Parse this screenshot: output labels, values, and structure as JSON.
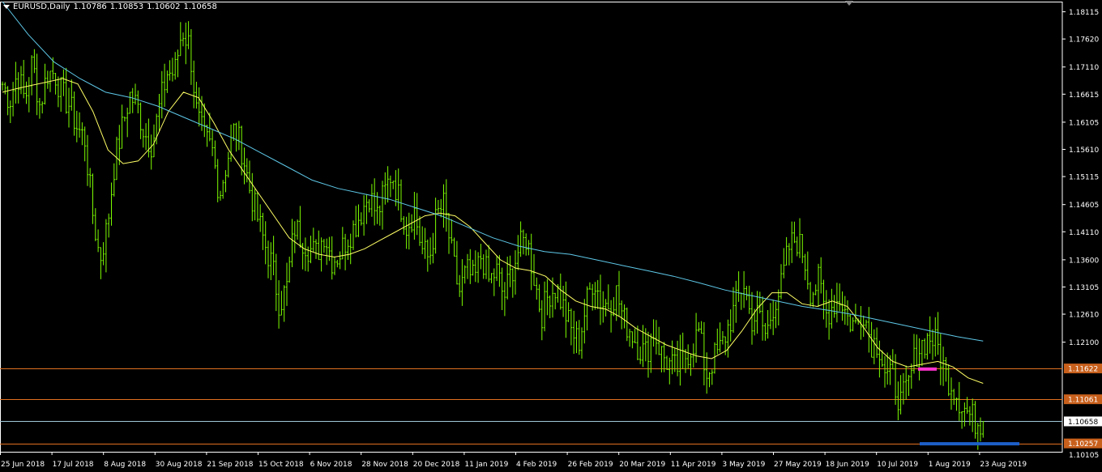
{
  "header": {
    "symbol": "EURUSD,Daily",
    "open": "1.10786",
    "high": "1.10853",
    "low": "1.10602",
    "close": "1.10658"
  },
  "colors": {
    "background": "#000000",
    "frame": "#ffffff",
    "bar": "#7CFC00",
    "ma_fast": "#ffff66",
    "ma_slow": "#5ec8e8",
    "hline_orange": "#e07020",
    "hline_current": "#a0c8d8",
    "marker_magenta": "#ff33cc",
    "marker_blue": "#1e5fc8",
    "label_orange_bg": "#c8601c",
    "axis_text": "#ffffff"
  },
  "chart_data": {
    "type": "ohlc",
    "symbol": "EURUSD",
    "timeframe": "Daily",
    "ylim": [
      1.10105,
      1.183
    ],
    "y_ticks": [
      "1.18115",
      "1.17620",
      "1.17110",
      "1.16615",
      "1.16105",
      "1.15610",
      "1.15115",
      "1.14605",
      "1.14110",
      "1.13600",
      "1.13105",
      "1.12610",
      "1.12100"
    ],
    "y_ticks_bottom": "1.10105",
    "x_labels": [
      "25 Jun 2018",
      "17 Jul 2018",
      "8 Aug 2018",
      "30 Aug 2018",
      "21 Sep 2018",
      "15 Oct 2018",
      "6 Nov 2018",
      "28 Nov 2018",
      "20 Dec 2018",
      "11 Jan 2019",
      "4 Feb 2019",
      "26 Feb 2019",
      "20 Mar 2019",
      "11 Apr 2019",
      "3 May 2019",
      "27 May 2019",
      "18 Jun 2019",
      "10 Jul 2019",
      "1 Aug 2019",
      "23 Aug 2019"
    ],
    "close_anchors": [
      [
        1.168,
        1.165
      ],
      [
        1.17,
        1.165
      ],
      [
        1.172,
        1.164
      ],
      [
        1.17,
        1.17
      ],
      [
        1.166,
        1.164
      ],
      [
        1.16,
        1.158
      ],
      [
        1.145,
        1.136
      ],
      [
        1.142,
        1.154
      ],
      [
        1.16,
        1.166
      ],
      [
        1.164,
        1.159
      ],
      [
        1.157,
        1.164
      ],
      [
        1.17,
        1.17
      ],
      [
        1.178,
        1.175
      ],
      [
        1.162,
        1.158
      ],
      [
        1.156,
        1.148
      ],
      [
        1.154,
        1.16
      ],
      [
        1.156,
        1.149
      ],
      [
        1.144,
        1.139
      ],
      [
        1.135,
        1.128
      ],
      [
        1.131,
        1.142
      ],
      [
        1.14,
        1.138
      ],
      [
        1.137,
        1.141
      ],
      [
        1.136,
        1.137
      ],
      [
        1.14,
        1.142
      ],
      [
        1.145,
        1.148
      ],
      [
        1.144,
        1.148
      ],
      [
        1.152,
        1.147
      ],
      [
        1.142,
        1.145
      ],
      [
        1.138,
        1.136
      ],
      [
        1.144,
        1.146
      ],
      [
        1.137,
        1.13
      ],
      [
        1.134,
        1.132
      ],
      [
        1.137,
        1.132
      ],
      [
        1.134,
        1.129
      ],
      [
        1.134,
        1.138
      ],
      [
        1.14,
        1.133
      ],
      [
        1.126,
        1.13
      ],
      [
        1.131,
        1.127
      ],
      [
        1.123,
        1.121
      ],
      [
        1.128,
        1.133
      ],
      [
        1.128,
        1.128
      ],
      [
        1.13,
        1.125
      ],
      [
        1.123,
        1.12
      ],
      [
        1.119,
        1.123
      ],
      [
        1.119,
        1.117
      ],
      [
        1.116,
        1.118
      ],
      [
        1.12,
        1.123
      ],
      [
        1.115,
        1.118
      ],
      [
        1.12,
        1.124
      ],
      [
        1.128,
        1.132
      ],
      [
        1.125,
        1.126
      ],
      [
        1.122,
        1.128
      ],
      [
        1.131,
        1.138
      ],
      [
        1.14,
        1.137
      ],
      [
        1.13,
        1.132
      ],
      [
        1.126,
        1.128
      ],
      [
        1.129,
        1.125
      ],
      [
        1.124,
        1.127
      ],
      [
        1.121,
        1.121
      ],
      [
        1.115,
        1.114
      ],
      [
        1.11,
        1.113
      ],
      [
        1.119,
        1.121
      ],
      [
        1.122,
        1.12
      ],
      [
        1.115,
        1.113
      ],
      [
        1.11,
        1.108
      ],
      [
        1.1066,
        1.1066
      ]
    ],
    "ma_fast_anchors": [
      1.1665,
      1.1672,
      1.1678,
      1.1684,
      1.169,
      1.168,
      1.163,
      1.156,
      1.1535,
      1.154,
      1.157,
      1.163,
      1.1665,
      1.1655,
      1.161,
      1.156,
      1.152,
      1.148,
      1.144,
      1.14,
      1.138,
      1.137,
      1.1365,
      1.137,
      1.138,
      1.1395,
      1.141,
      1.1425,
      1.144,
      1.1445,
      1.144,
      1.142,
      1.139,
      1.136,
      1.1345,
      1.134,
      1.133,
      1.1305,
      1.1285,
      1.1275,
      1.127,
      1.1255,
      1.1235,
      1.122,
      1.1205,
      1.1195,
      1.1185,
      1.118,
      1.1195,
      1.123,
      1.127,
      1.13,
      1.13,
      1.128,
      1.1275,
      1.1285,
      1.1275,
      1.124,
      1.12,
      1.1175,
      1.1165,
      1.117,
      1.1175,
      1.1165,
      1.1145,
      1.1135
    ],
    "ma_fast_start_bar": 0,
    "ma_slow_anchors": [
      1.183,
      1.177,
      1.172,
      1.169,
      1.1665,
      1.1655,
      1.164,
      1.162,
      1.16,
      1.158,
      1.1555,
      1.153,
      1.1505,
      1.149,
      1.148,
      1.147,
      1.1455,
      1.144,
      1.142,
      1.14,
      1.1385,
      1.1375,
      1.137,
      1.136,
      1.135,
      1.134,
      1.133,
      1.1318,
      1.1305,
      1.1295,
      1.1285,
      1.1275,
      1.1268,
      1.126,
      1.125,
      1.124,
      1.123,
      1.122,
      1.1212
    ],
    "ma_slow_start_bar": 48,
    "horizontal_lines": [
      {
        "price": 1.11622,
        "label": "1.11622",
        "kind": "orange"
      },
      {
        "price": 1.11061,
        "label": "1.11061",
        "kind": "orange"
      },
      {
        "price": 1.10658,
        "label": "1.10658",
        "kind": "current"
      },
      {
        "price": 1.10257,
        "label": "1.10257",
        "kind": "orange"
      }
    ],
    "markers": [
      {
        "kind": "magenta",
        "price": 1.1161
      },
      {
        "kind": "blue",
        "price": 1.1025
      }
    ]
  }
}
